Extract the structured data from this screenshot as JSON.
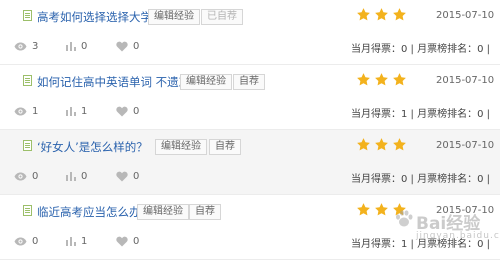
{
  "rows": [
    {
      "title": "高考如何选择选择大学",
      "buttons": [
        {
          "label": "编辑经验",
          "state": "normal"
        },
        {
          "label": "已自荐",
          "state": "disabled"
        }
      ],
      "stars": 3,
      "date": "2015-07-10",
      "views": "3",
      "votes": "0",
      "likes": "0",
      "rank_text": "当月得票：0 | 月票榜排名：0 |"
    },
    {
      "title": "如何记住高中英语单词 不遗忘",
      "buttons": [
        {
          "label": "编辑经验",
          "state": "normal"
        },
        {
          "label": "自荐",
          "state": "normal"
        }
      ],
      "stars": 3,
      "date": "2015-07-10",
      "views": "1",
      "votes": "1",
      "likes": "0",
      "rank_text": "当月得票：1 | 月票榜排名：0 |"
    },
    {
      "title": "‘好女人’是怎么样的？",
      "buttons": [
        {
          "label": "编辑经验",
          "state": "normal"
        },
        {
          "label": "自荐",
          "state": "normal"
        }
      ],
      "stars": 3,
      "date": "2015-07-10",
      "views": "0",
      "votes": "0",
      "likes": "0",
      "rank_text": "当月得票：0 | 月票榜排名：0 |"
    },
    {
      "title": "临近高考应当怎么办",
      "buttons": [
        {
          "label": "编辑经验",
          "state": "normal"
        },
        {
          "label": "自荐",
          "state": "normal"
        }
      ],
      "stars": 3,
      "date": "2015-07-10",
      "views": "0",
      "votes": "1",
      "likes": "0",
      "rank_text": "当月得票：1 | 月票榜排名：0 |"
    }
  ],
  "watermark": {
    "text": "Bai经验",
    "sub": "jingyan.baidu.com"
  },
  "icons": {
    "doc": "document-icon",
    "star": "star-icon",
    "views": "eye-icon",
    "votes": "bar-chart-icon",
    "likes": "heart-icon"
  },
  "colors": {
    "title_link": "#2a62ad",
    "star": "#f3b21d",
    "alt_row_bg": "#f5f5f5",
    "icon_gray": "#b8b8b8"
  }
}
